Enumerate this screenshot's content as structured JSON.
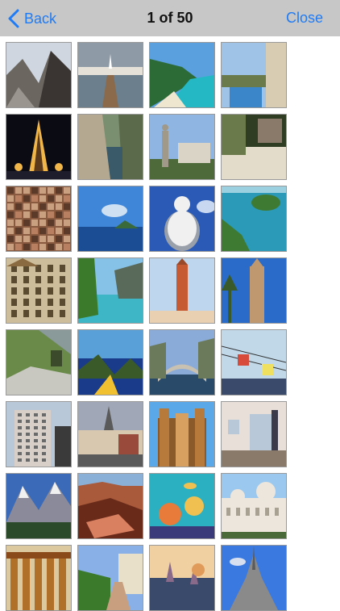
{
  "nav": {
    "back_label": "Back",
    "title": "1 of 50",
    "close_label": "Close",
    "accent_color": "#1f7bf6",
    "bar_color": "#c7c7c7"
  },
  "thumbnails": [
    {
      "name": "rocky-mountain-peak",
      "palette": [
        "#cfd6e0",
        "#6c6660",
        "#3a3532",
        "#9b9590"
      ],
      "kind": "mountain"
    },
    {
      "name": "pier-with-church-town",
      "palette": [
        "#8e9aa6",
        "#e6e1d8",
        "#6b7f8c",
        "#8a6a4a"
      ],
      "kind": "pier"
    },
    {
      "name": "tropical-beach-cove",
      "palette": [
        "#5aa0de",
        "#2c6b35",
        "#24b8c4",
        "#efe6cf"
      ],
      "kind": "beach"
    },
    {
      "name": "resort-balcony-view",
      "palette": [
        "#9ec3e6",
        "#d8ccb2",
        "#3b86c9",
        "#6a7a4a"
      ],
      "kind": "balcony"
    },
    {
      "name": "eiffel-tower-night",
      "palette": [
        "#0b0b14",
        "#f0b64a",
        "#5a3a1a",
        "#1d1d2c"
      ],
      "kind": "tower"
    },
    {
      "name": "river-canyon-gorge",
      "palette": [
        "#7a8e70",
        "#b5a890",
        "#3a5a6a",
        "#5a6a4a"
      ],
      "kind": "canyon"
    },
    {
      "name": "monument-and-palace",
      "palette": [
        "#8fb6e3",
        "#d9d4c6",
        "#4e6a3a",
        "#a09888"
      ],
      "kind": "palace"
    },
    {
      "name": "courtyard-garden",
      "palette": [
        "#2f3d23",
        "#e4dccb",
        "#6a7a4a",
        "#8a7a6a"
      ],
      "kind": "courtyard"
    },
    {
      "name": "aerial-city-view",
      "palette": [
        "#8a5a40",
        "#b88060",
        "#5c3a2a",
        "#c9a080"
      ],
      "kind": "aerial"
    },
    {
      "name": "blue-sea-island",
      "palette": [
        "#3f86d9",
        "#1b4d94",
        "#3a6a3a",
        "#cfe0f2"
      ],
      "kind": "sea"
    },
    {
      "name": "white-buddha-statue",
      "palette": [
        "#2a5ab5",
        "#f0f0f0",
        "#9aa0aa",
        "#c8d8f0"
      ],
      "kind": "buddha"
    },
    {
      "name": "lagoon-island",
      "palette": [
        "#2a9ab8",
        "#3f7a32",
        "#1a5a8a",
        "#9ad0e0"
      ],
      "kind": "lagoon"
    },
    {
      "name": "ornate-stone-building",
      "palette": [
        "#cdbd9a",
        "#8a6a40",
        "#5a4a30",
        "#dccca8"
      ],
      "kind": "building"
    },
    {
      "name": "cliffs-beach-bay",
      "palette": [
        "#86c1e8",
        "#3fb6c6",
        "#5a6a5a",
        "#3a7a2a"
      ],
      "kind": "cliffs"
    },
    {
      "name": "clock-tower-plaza",
      "palette": [
        "#bed6ee",
        "#c65a32",
        "#9a4a2a",
        "#e8d0b0"
      ],
      "kind": "clocktower"
    },
    {
      "name": "church-spire-palms",
      "palette": [
        "#2a6ac8",
        "#c09870",
        "#3a5a2a",
        "#e0c8a0"
      ],
      "kind": "spire"
    },
    {
      "name": "mountain-hikers",
      "palette": [
        "#6a8a4a",
        "#c8c8c0",
        "#3a4a2a",
        "#8a9a9a"
      ],
      "kind": "hikers"
    },
    {
      "name": "mountain-lake-sunset",
      "palette": [
        "#1a3a8a",
        "#f0c030",
        "#5aa0d8",
        "#3a5a2a"
      ],
      "kind": "lake"
    },
    {
      "name": "old-bridge-town",
      "palette": [
        "#8aaad8",
        "#6a7a5a",
        "#c8c0b0",
        "#2a4a6a"
      ],
      "kind": "bridge"
    },
    {
      "name": "cable-car-gondolas",
      "palette": [
        "#c0d8e8",
        "#d84a3a",
        "#3a4a6a",
        "#f0e060"
      ],
      "kind": "gondola"
    },
    {
      "name": "tall-city-tower",
      "palette": [
        "#b8c8d8",
        "#d8d0c8",
        "#6a6a6a",
        "#3a3a3a"
      ],
      "kind": "skyscraper"
    },
    {
      "name": "old-town-street",
      "palette": [
        "#a0a8b8",
        "#d8c8b0",
        "#9a4a3a",
        "#5a5a5a"
      ],
      "kind": "street"
    },
    {
      "name": "mud-mosque",
      "palette": [
        "#5aa8e8",
        "#b87a3a",
        "#8a5a2a",
        "#d8a060"
      ],
      "kind": "mosque"
    },
    {
      "name": "hotel-room",
      "palette": [
        "#e8e0d8",
        "#b8c8d8",
        "#3a3a4a",
        "#8a7a6a"
      ],
      "kind": "room"
    },
    {
      "name": "snowy-peaks-forest",
      "palette": [
        "#3a6ab8",
        "#f0f0f0",
        "#2a4a2a",
        "#8a8a9a"
      ],
      "kind": "snowpeaks"
    },
    {
      "name": "red-rock-canyon",
      "palette": [
        "#a85a3a",
        "#6a2a1a",
        "#d88060",
        "#8ab0d8"
      ],
      "kind": "redrock"
    },
    {
      "name": "coral-reef",
      "palette": [
        "#2ab0c0",
        "#e87a3a",
        "#3a3a7a",
        "#f0c050"
      ],
      "kind": "reef"
    },
    {
      "name": "white-palace-domes",
      "palette": [
        "#9ac8ee",
        "#ece6dc",
        "#a8a090",
        "#4a6a3a"
      ],
      "kind": "domes"
    },
    {
      "name": "greek-temple-columns",
      "palette": [
        "#dcc9a0",
        "#b0702a",
        "#8a4a1a",
        "#6a3a10"
      ],
      "kind": "temple"
    },
    {
      "name": "garden-walkway",
      "palette": [
        "#8ab0e8",
        "#3a7a2a",
        "#c8a080",
        "#e8e0c8"
      ],
      "kind": "garden"
    },
    {
      "name": "harbor-sunset",
      "palette": [
        "#e09a5a",
        "#8a6a8a",
        "#3a4a6a",
        "#f0d0a0"
      ],
      "kind": "harbor"
    },
    {
      "name": "mont-saint-michel",
      "palette": [
        "#3a7ae0",
        "#8a8a8a",
        "#5a5a5a",
        "#d8e0f0"
      ],
      "kind": "abbey"
    }
  ]
}
